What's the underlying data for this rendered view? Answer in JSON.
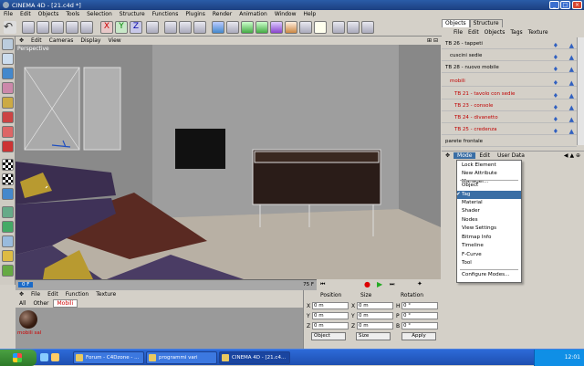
{
  "window": {
    "title": "CINEMA 4D - [21.c4d *]"
  },
  "menubar": [
    "File",
    "Edit",
    "Objects",
    "Tools",
    "Selection",
    "Structure",
    "Functions",
    "Plugins",
    "Render",
    "Animation",
    "Window",
    "Help"
  ],
  "viewport": {
    "menu": [
      "Edit",
      "Cameras",
      "Display",
      "View"
    ],
    "label": "Perspective"
  },
  "timeline": {
    "start": "0 F",
    "end": "75 F"
  },
  "materials": {
    "menu": [
      "File",
      "Edit",
      "Function",
      "Texture"
    ],
    "tabs": [
      "All",
      "Other",
      "Mobili"
    ],
    "item_label": "mobili sal"
  },
  "coords": {
    "headers": [
      "Position",
      "Size",
      "Rotation"
    ],
    "axes": [
      [
        "X",
        "X",
        "H"
      ],
      [
        "Y",
        "Y",
        "P"
      ],
      [
        "Z",
        "Z",
        "B"
      ]
    ],
    "pos": [
      "0 m",
      "0 m",
      "0 m"
    ],
    "size": [
      "0 m",
      "0 m",
      "0 m"
    ],
    "rot": [
      "0 °",
      "0 °",
      "0 °"
    ],
    "mode1": "Object",
    "mode2": "Size",
    "apply": "Apply"
  },
  "objects": {
    "tabs": [
      "Objects",
      "Structure"
    ],
    "menu": [
      "File",
      "Edit",
      "Objects",
      "Tags",
      "Texture"
    ],
    "rows": [
      {
        "label": "TB 26 - tappeti",
        "color": "#000000"
      },
      {
        "label": "cuscini sedie",
        "color": "#000000"
      },
      {
        "label": "TB 28 - nuovo mobile",
        "color": "#000000"
      },
      {
        "label": "mobili",
        "color": "#c00000"
      },
      {
        "label": "TB 21 - tavolo con sedie",
        "color": "#c00000"
      },
      {
        "label": "TB 23 - console",
        "color": "#c00000"
      },
      {
        "label": "TB 24 - divanetto",
        "color": "#c00000"
      },
      {
        "label": "TB 25 - credenza",
        "color": "#c00000"
      },
      {
        "label": "parete frontale",
        "color": "#000000"
      }
    ]
  },
  "attributes": {
    "menu": [
      "Mode",
      "Edit",
      "User Data"
    ]
  },
  "mode_menu": {
    "items": [
      "Lock Element",
      "New Attribute Manager...",
      "Object",
      "Tag",
      "Material",
      "Shader",
      "Nodes",
      "View Settings",
      "Bitmap Info",
      "Timeline",
      "F-Curve",
      "Tool",
      "Configure Modes..."
    ],
    "selected": "Tag"
  },
  "taskbar": {
    "items": [
      "Forum - C4Dzone - ...",
      "programmi vari",
      "CINEMA 4D - [21.c4..."
    ],
    "clock": "12:01"
  }
}
